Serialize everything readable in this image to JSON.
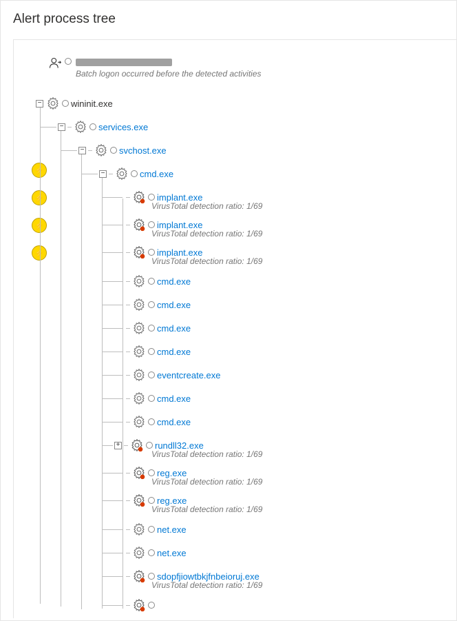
{
  "title": "Alert process tree",
  "user": {
    "subnote": "Batch logon occurred before the detected activities"
  },
  "vt_label": "VirusTotal detection ratio: 1/69",
  "expanders": {
    "minus": "−",
    "plus": "+"
  },
  "proc": {
    "wininit": "wininit.exe",
    "services": "services.exe",
    "svchost": "svchost.exe",
    "cmd_parent": "cmd.exe",
    "implant": "implant.exe",
    "cmd": "cmd.exe",
    "eventcreate": "eventcreate.exe",
    "rundll32": "rundll32.exe",
    "reg": "reg.exe",
    "net": "net.exe",
    "sdop": "sdopfjiowtbkjfnbeioruj.exe"
  }
}
